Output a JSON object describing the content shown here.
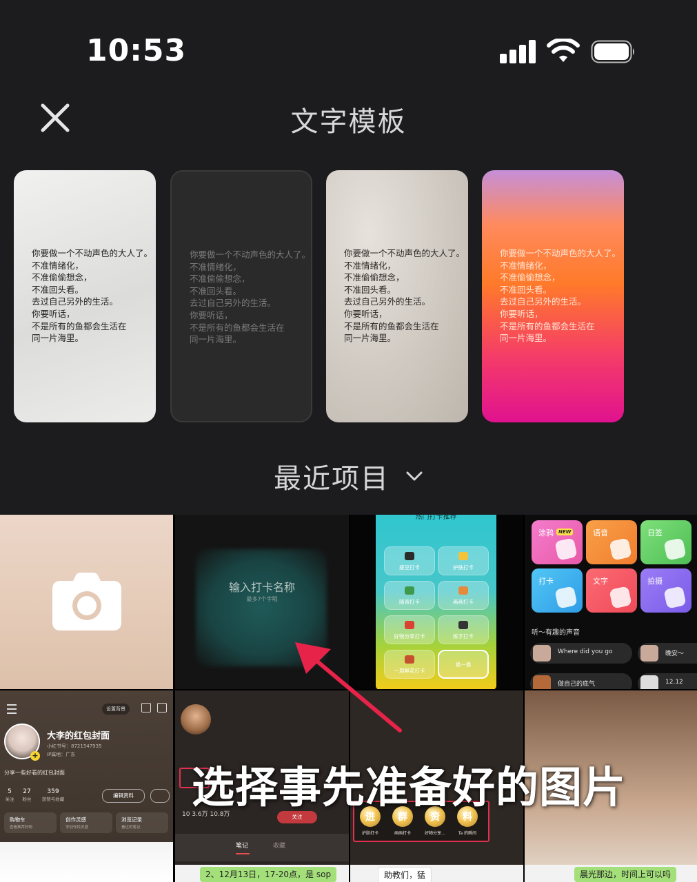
{
  "status_bar": {
    "time": "10:53"
  },
  "header": {
    "title": "文字模板"
  },
  "templates": [
    {
      "text": "你要做一个不动声色的大人了。\n不准情绪化，\n不准偷偷想念，\n不准回头看。\n去过自己另外的生活。\n你要听话，\n不是所有的鱼都会生活在\n同一片海里。"
    },
    {
      "text": "你要做一个不动声色的大人了。\n不准情绪化，\n不准偷偷想念，\n不准回头看。\n去过自己另外的生活。\n你要听话，\n不是所有的鱼都会生活在\n同一片海里。"
    },
    {
      "text": "你要做一个不动声色的大人了。\n不准情绪化，\n不准偷偷想念，\n不准回头看。\n去过自己另外的生活。\n你要听话，\n不是所有的鱼都会生活在\n同一片海里。"
    },
    {
      "text": "你要做一个不动声色的大人了。\n不准情绪化，\n不准偷偷想念，\n不准回头看。\n去过自己另外的生活。\n你要听话，\n不是所有的鱼都会生活在\n同一片海里。"
    }
  ],
  "section": {
    "label": "最近项目"
  },
  "photos": {
    "c2": {
      "main": "输入打卡名称",
      "sub": "最多7个字哦"
    },
    "c3": {
      "title": "热门打卡推荐",
      "buttons": [
        "瘦豆打卡",
        "护肤打卡",
        "随青打卡",
        "画画打卡",
        "好物分享打卡",
        "练字打卡",
        "一周鲜花打卡",
        "换一换"
      ]
    },
    "c4": {
      "tiles": [
        "涂鸦",
        "语音",
        "日签",
        "打卡",
        "文字",
        "拍摄"
      ],
      "new_badge": "NEW",
      "sounds_title": "听～有趣的声音",
      "pills": [
        "Where did you go",
        "晚安～",
        "做自己的底气",
        "12.12"
      ]
    },
    "c5": {
      "bg_button": "设置背景",
      "name": "大李的红包封面",
      "id": "小红书号：8721547935",
      "location": "IP属地：广东",
      "bio": "分享一些好看的红包封面",
      "stats": [
        {
          "n": "5",
          "l": "关注"
        },
        {
          "n": "27",
          "l": "粉丝"
        },
        {
          "n": "359",
          "l": "获赞与收藏"
        }
      ],
      "edit": "编辑资料",
      "shortcuts": [
        {
          "a": "购物车",
          "b": "查看推荐好物"
        },
        {
          "a": "创作灵感",
          "b": "学创作找灵感"
        },
        {
          "a": "浏览记录",
          "b": "看过的笔记"
        }
      ]
    },
    "c6": {
      "stats": "10    3.6万    10.8万",
      "follow": "关注",
      "tab_notes": "笔记",
      "tab_collect": "收藏"
    },
    "c7": {
      "coins": [
        {
          "glyph": "进",
          "label": "护肤打卡"
        },
        {
          "glyph": "群",
          "label": "画画打卡"
        },
        {
          "glyph": "资",
          "label": "好物分享…"
        },
        {
          "glyph": "料",
          "label": "Ta 的瞬间"
        }
      ]
    }
  },
  "bottom_strip": {
    "b1": "2、12月13日，17-20点，是 sop",
    "b2": "助教们，猛",
    "b3": "晨光那边，时间上可以吗"
  },
  "overlay": {
    "caption": "选择事先准备好的图片"
  },
  "colors": {
    "background": "#1c1c1e",
    "arrow": "#e8234a",
    "caption": "#ffffff"
  }
}
